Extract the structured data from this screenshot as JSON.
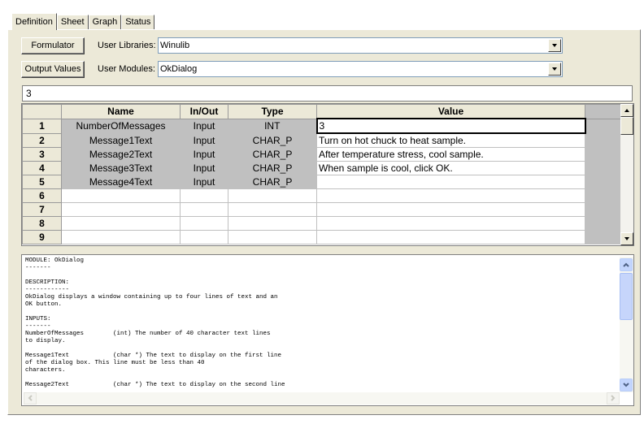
{
  "tabs": [
    {
      "label": "Definition",
      "active": true
    },
    {
      "label": "Sheet",
      "active": false
    },
    {
      "label": "Graph",
      "active": false
    },
    {
      "label": "Status",
      "active": false
    }
  ],
  "toolbar": {
    "formulator_label": "Formulator",
    "output_values_label": "Output Values",
    "user_libraries_label": "User Libraries:",
    "user_libraries_value": "Winulib",
    "user_modules_label": "User Modules:",
    "user_modules_value": "OkDialog"
  },
  "edit_bar_value": "3",
  "grid": {
    "headers": [
      "Name",
      "In/Out",
      "Type",
      "Value"
    ],
    "rows": [
      {
        "num": "1",
        "name": "NumberOfMessages",
        "inout": "Input",
        "type": "INT",
        "value": "3"
      },
      {
        "num": "2",
        "name": "Message1Text",
        "inout": "Input",
        "type": "CHAR_P",
        "value": "Turn on hot chuck to heat sample."
      },
      {
        "num": "3",
        "name": "Message2Text",
        "inout": "Input",
        "type": "CHAR_P",
        "value": "After temperature stress, cool sample."
      },
      {
        "num": "4",
        "name": "Message3Text",
        "inout": "Input",
        "type": "CHAR_P",
        "value": "When sample is cool, click OK."
      },
      {
        "num": "5",
        "name": "Message4Text",
        "inout": "Input",
        "type": "CHAR_P",
        "value": ""
      },
      {
        "num": "6",
        "name": "",
        "inout": "",
        "type": "",
        "value": ""
      },
      {
        "num": "7",
        "name": "",
        "inout": "",
        "type": "",
        "value": ""
      },
      {
        "num": "8",
        "name": "",
        "inout": "",
        "type": "",
        "value": ""
      },
      {
        "num": "9",
        "name": "",
        "inout": "",
        "type": "",
        "value": ""
      }
    ]
  },
  "description": {
    "text": "MODULE: OkDialog\n-------\n\nDESCRIPTION:\n------------\nOkDialog displays a window containing up to four lines of text and an\nOK button.\n\nINPUTS:\n-------\nNumberOfMessages        (int) The number of 40 character text lines\nto display.\n\nMessage1Text            (char *) The text to display on the first line\nof the dialog box. This line must be less than 40\ncharacters.\n\nMessage2Text            (char *) The text to display on the second line"
  },
  "colors": {
    "panel": "#ece9d8",
    "grid_gray": "#c0c0c0",
    "xp_scroll": "#c3d5fd"
  }
}
